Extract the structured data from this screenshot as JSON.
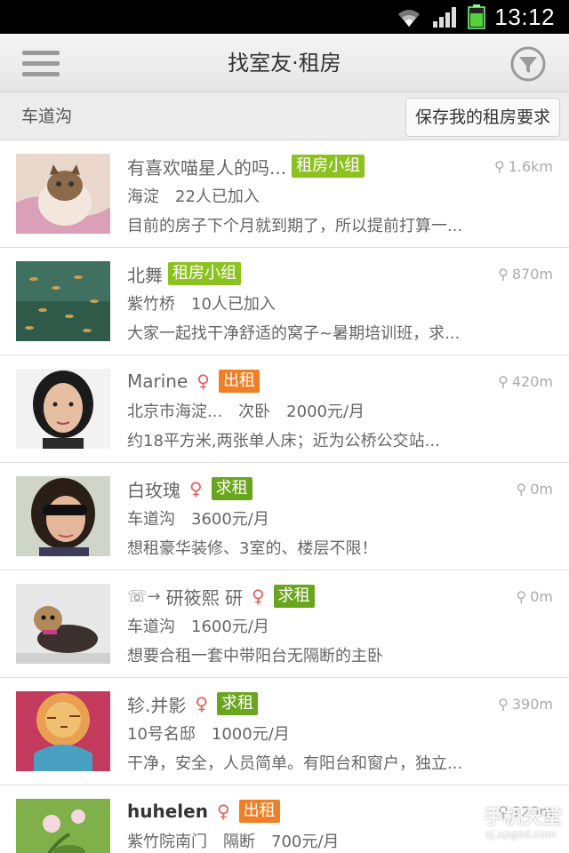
{
  "status_bar": {
    "time": "13:12",
    "icons": [
      "wifi-icon",
      "signal-icon",
      "battery-icon"
    ],
    "accent": "#000000"
  },
  "header": {
    "title": "找室友·租房",
    "menu_icon": "menu-icon",
    "filter_icon": "filter-icon"
  },
  "location_bar": {
    "location": "车道沟",
    "save_button": "保存我的租房要求"
  },
  "colors": {
    "tag_group": "#8cc21f",
    "tag_rent": "#ef7f26",
    "tag_seek": "#6aa51e",
    "gender": "#e0605f"
  },
  "listings": [
    {
      "name": "有喜欢喵星人的吗...",
      "tag": "租房小组",
      "distance": "1.6km",
      "area": "海淀",
      "detail": "22人已加入",
      "description": "目前的房子下个月就到期了，所以提前打算一..."
    },
    {
      "name": "北舞",
      "tag": "租房小组",
      "distance": "870m",
      "area": "紫竹桥",
      "detail": "10人已加入",
      "description": "大家一起找干净舒适的窝子~暑期培训班，求..."
    },
    {
      "name": "Marine",
      "gender": "♀",
      "tag": "出租",
      "distance": "420m",
      "area": "北京市海淀...",
      "room": "次卧",
      "price": "2000元/月",
      "description": "约18平方米,两张单人床；近为公桥公交站..."
    },
    {
      "name": "白玫瑰",
      "gender": "♀",
      "tag": "求租",
      "distance": "0m",
      "area": "车道沟",
      "price": "3600元/月",
      "description": "想租豪华装修、3室的、楼层不限！"
    },
    {
      "prefix": "☏→",
      "name": "研筱熙 研",
      "gender": "♀",
      "tag": "求租",
      "distance": "0m",
      "area": "车道沟",
      "price": "1600元/月",
      "description": "想要合租一套中带阳台无隔断的主卧"
    },
    {
      "name": "轸.并影",
      "gender": "♀",
      "tag": "求租",
      "distance": "390m",
      "area": "10号名邸",
      "price": "1000元/月",
      "description": "干净，安全，人员简单。有阳台和窗户，独立..."
    },
    {
      "name": "huhelen",
      "gender": "♀",
      "tag": "出租",
      "distance": "920m",
      "area": "紫竹院南门",
      "room": "隔断",
      "price": "700元/月",
      "description": ""
    }
  ],
  "watermark": {
    "line1": "手机天堂",
    "line2": "sj.xpgod.com"
  }
}
